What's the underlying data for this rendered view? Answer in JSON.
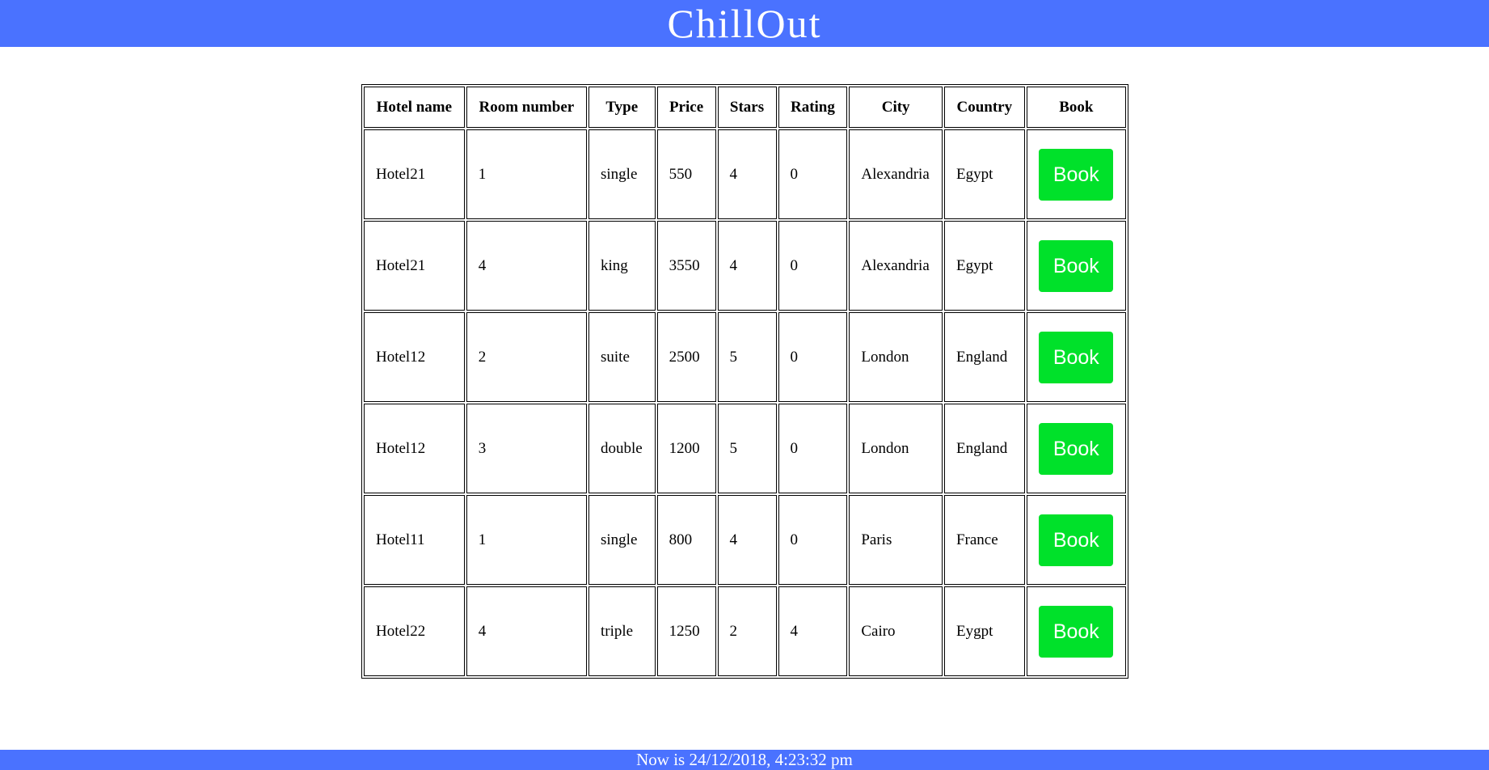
{
  "header": {
    "title": "ChillOut"
  },
  "table": {
    "columns": [
      "Hotel name",
      "Room number",
      "Type",
      "Price",
      "Stars",
      "Rating",
      "City",
      "Country",
      "Book"
    ],
    "rows": [
      {
        "hotel": "Hotel21",
        "room": "1",
        "type": "single",
        "price": "550",
        "stars": "4",
        "rating": "0",
        "city": "Alexandria",
        "country": "Egypt",
        "book_label": "Book"
      },
      {
        "hotel": "Hotel21",
        "room": "4",
        "type": "king",
        "price": "3550",
        "stars": "4",
        "rating": "0",
        "city": "Alexandria",
        "country": "Egypt",
        "book_label": "Book"
      },
      {
        "hotel": "Hotel12",
        "room": "2",
        "type": "suite",
        "price": "2500",
        "stars": "5",
        "rating": "0",
        "city": "London",
        "country": "England",
        "book_label": "Book"
      },
      {
        "hotel": "Hotel12",
        "room": "3",
        "type": "double",
        "price": "1200",
        "stars": "5",
        "rating": "0",
        "city": "London",
        "country": "England",
        "book_label": "Book"
      },
      {
        "hotel": "Hotel11",
        "room": "1",
        "type": "single",
        "price": "800",
        "stars": "4",
        "rating": "0",
        "city": "Paris",
        "country": "France",
        "book_label": "Book"
      },
      {
        "hotel": "Hotel22",
        "room": "4",
        "type": "triple",
        "price": "1250",
        "stars": "2",
        "rating": "4",
        "city": "Cairo",
        "country": "Eygpt",
        "book_label": "Book"
      }
    ]
  },
  "footer": {
    "text": "Now is 24/12/2018, 4:23:32 pm"
  },
  "colors": {
    "brand": "#4a72ff",
    "book_button": "#00e12a"
  }
}
